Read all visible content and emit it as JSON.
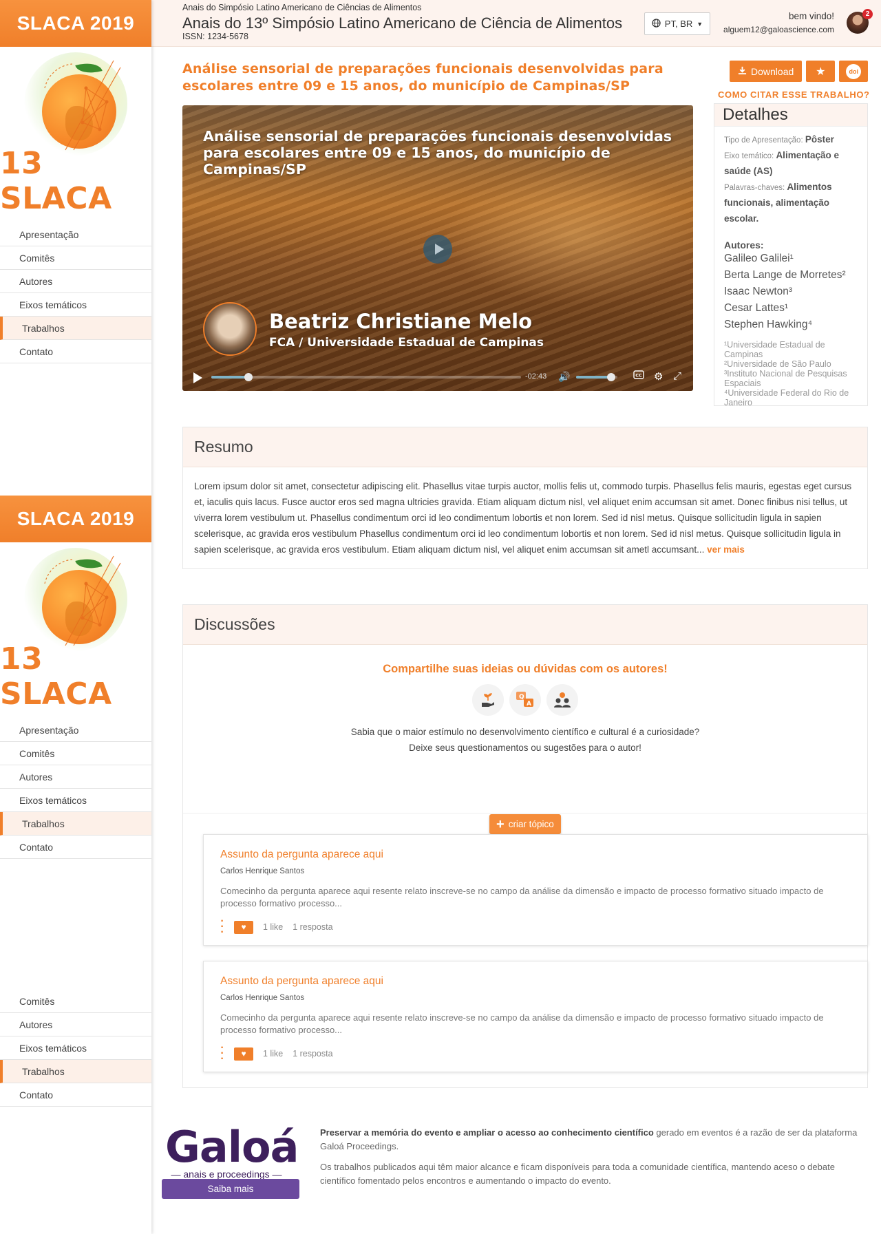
{
  "sidebar": {
    "brand": "SLACA 2019",
    "logo_text": "13 SLACA",
    "nav_full": [
      "Apresentação",
      "Comitês",
      "Autores",
      "Eixos temáticos",
      "Trabalhos",
      "Contato"
    ],
    "nav_short": [
      "Comitês",
      "Autores",
      "Eixos temáticos",
      "Trabalhos",
      "Contato"
    ],
    "active": "Trabalhos"
  },
  "header": {
    "subtitle": "Anais do Simpósio Latino Americano de Ciências de Alimentos",
    "title": "Anais do 13º Simpósio Latino Americano de Ciência de Alimentos",
    "issn": "ISSN: 1234-5678",
    "language": "PT, BR",
    "welcome": "bem vindo!",
    "email": "alguem12@galoascience.com",
    "notifications": "2"
  },
  "work": {
    "title": "Análise sensorial de preparações funcionais desenvolvidas para escolares entre 09 e 15 anos, do município de Campinas/SP",
    "download_label": "Download",
    "doi_label": "doi",
    "cite_link": "COMO CITAR ESSE TRABALHO?"
  },
  "video": {
    "title": "Análise sensorial de preparações funcionais desenvolvidas para escolares entre 09 e 15 anos, do município de Campinas/SP",
    "presenter_name": "Beatriz Christiane Melo",
    "presenter_inst": "FCA / Universidade Estadual de Campinas",
    "time_remaining": "-02:43",
    "progress": 0.12,
    "volume": 0.85
  },
  "details": {
    "heading": "Detalhes",
    "tipo_label": "Tipo de Apresentação:",
    "tipo_value": "Pôster",
    "eixo_label": "Eixo temático:",
    "eixo_value": "Alimentação e saúde (AS)",
    "palavras_label": "Palavras-chaves:",
    "palavras_value": "Alimentos funcionais, alimentação escolar.",
    "authors_heading": "Autores:",
    "authors": [
      "Galileo Galilei¹",
      "Berta Lange de Morretes²",
      "Isaac Newton³",
      "Cesar Lattes¹",
      "Stephen Hawking⁴"
    ],
    "affiliations": [
      "¹Universidade Estadual de Campinas",
      "²Universidade de São Paulo",
      "³Instituto Nacional de Pesquisas Espaciais",
      "⁴Universidade Federal do Rio de Janeiro"
    ]
  },
  "resumo": {
    "heading": "Resumo",
    "text": "Lorem ipsum dolor sit amet, consectetur adipiscing elit. Phasellus vitae turpis auctor, mollis felis ut, commodo turpis. Phasellus felis mauris, egestas eget cursus et, iaculis quis lacus. Fusce auctor eros sed magna ultricies gravida. Etiam aliquam dictum nisl, vel aliquet enim accumsan sit amet. Donec finibus nisi tellus, ut viverra lorem vestibulum ut. Phasellus condimentum orci id leo condimentum lobortis et non lorem. Sed id nisl metus. Quisque sollicitudin ligula in sapien scelerisque, ac gravida eros vestibulum Phasellus condimentum orci id leo condimentum lobortis et non lorem. Sed id nisl metus. Quisque sollicitudin ligula in sapien scelerisque, ac gravida eros vestibulum. Etiam aliquam dictum nisl, vel aliquet enim accumsan sit ametl accumsant...",
    "more": "ver mais"
  },
  "discussoes": {
    "heading": "Discussões",
    "cta_heading": "Compartilhe suas ideias ou dúvidas com os autores!",
    "cta_line1": "Sabia que o maior estímulo no desenvolvimento científico e cultural é a curiosidade?",
    "cta_line2": "Deixe seus questionamentos ou sugestões para o autor!",
    "create_label": "criar tópico",
    "topics": [
      {
        "title": "Assunto da pergunta aparece aqui",
        "author": "Carlos Henrique Santos",
        "snippet": "Comecinho da pergunta aparece aqui resente relato inscreve-se no campo da análise da dimensão e impacto de processo formativo situado impacto de processo formativo processo...",
        "likes": "1 like",
        "replies": "1 resposta"
      },
      {
        "title": "Assunto da pergunta aparece aqui",
        "author": "Carlos Henrique Santos",
        "snippet": "Comecinho da pergunta aparece aqui resente relato inscreve-se no campo da análise da dimensão e impacto de processo formativo situado impacto de processo formativo processo...",
        "likes": "1 like",
        "replies": "1 resposta"
      }
    ]
  },
  "footer": {
    "logo": "Galoá",
    "logo_sub": "anais e proceedings",
    "saiba_mais": "Saiba mais",
    "para1_bold": "Preservar a memória do evento e ampliar o acesso ao conhecimento científico",
    "para1_rest": " gerado em eventos é a razão de ser da plataforma Galoá Proceedings.",
    "para2": "Os trabalhos publicados aqui têm maior alcance e ficam disponíveis para toda a comunidade científica, mantendo aceso o debate científico fomentado pelos encontros e aumentando o impacto do evento."
  },
  "colors": {
    "accent": "#f07f2a",
    "header_bg": "#fdf3ee",
    "galoa_purple": "#3d1f5c",
    "saiba_button": "#6b4a9e"
  }
}
